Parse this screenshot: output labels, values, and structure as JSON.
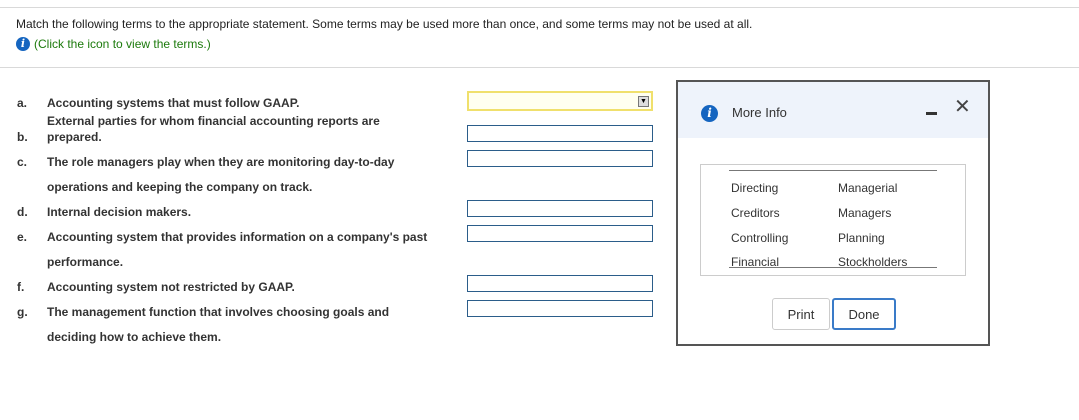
{
  "instructions": "Match the following terms to the appropriate statement. Some terms may be used more than once, and some terms may not be used at all.",
  "hint": "(Click the icon to view the terms.)",
  "info_glyph": "i",
  "questions": [
    {
      "letter": "a.",
      "lines": [
        "Accounting systems that must follow GAAP."
      ]
    },
    {
      "letter": "b.",
      "lines": [
        "External parties for whom financial accounting reports are",
        "prepared."
      ]
    },
    {
      "letter": "c.",
      "lines": [
        "The role managers play when they are monitoring day-to-day",
        "operations and keeping the company on track."
      ]
    },
    {
      "letter": "d.",
      "lines": [
        "Internal decision makers."
      ]
    },
    {
      "letter": "e.",
      "lines": [
        "Accounting system that provides information on a company's past",
        "performance."
      ]
    },
    {
      "letter": "f.",
      "lines": [
        "Accounting system not restricted by GAAP."
      ]
    },
    {
      "letter": "g.",
      "lines": [
        "The management function that involves choosing goals and",
        "deciding how to achieve them."
      ]
    }
  ],
  "dropdown_arrow": "▼",
  "modal": {
    "title": "More Info",
    "close_glyph": "✕",
    "terms_left": [
      "Directing",
      "Creditors",
      "Controlling",
      "Financial"
    ],
    "terms_right": [
      "Managerial",
      "Managers",
      "Planning",
      "Stockholders"
    ],
    "print_label": "Print",
    "done_label": "Done"
  }
}
